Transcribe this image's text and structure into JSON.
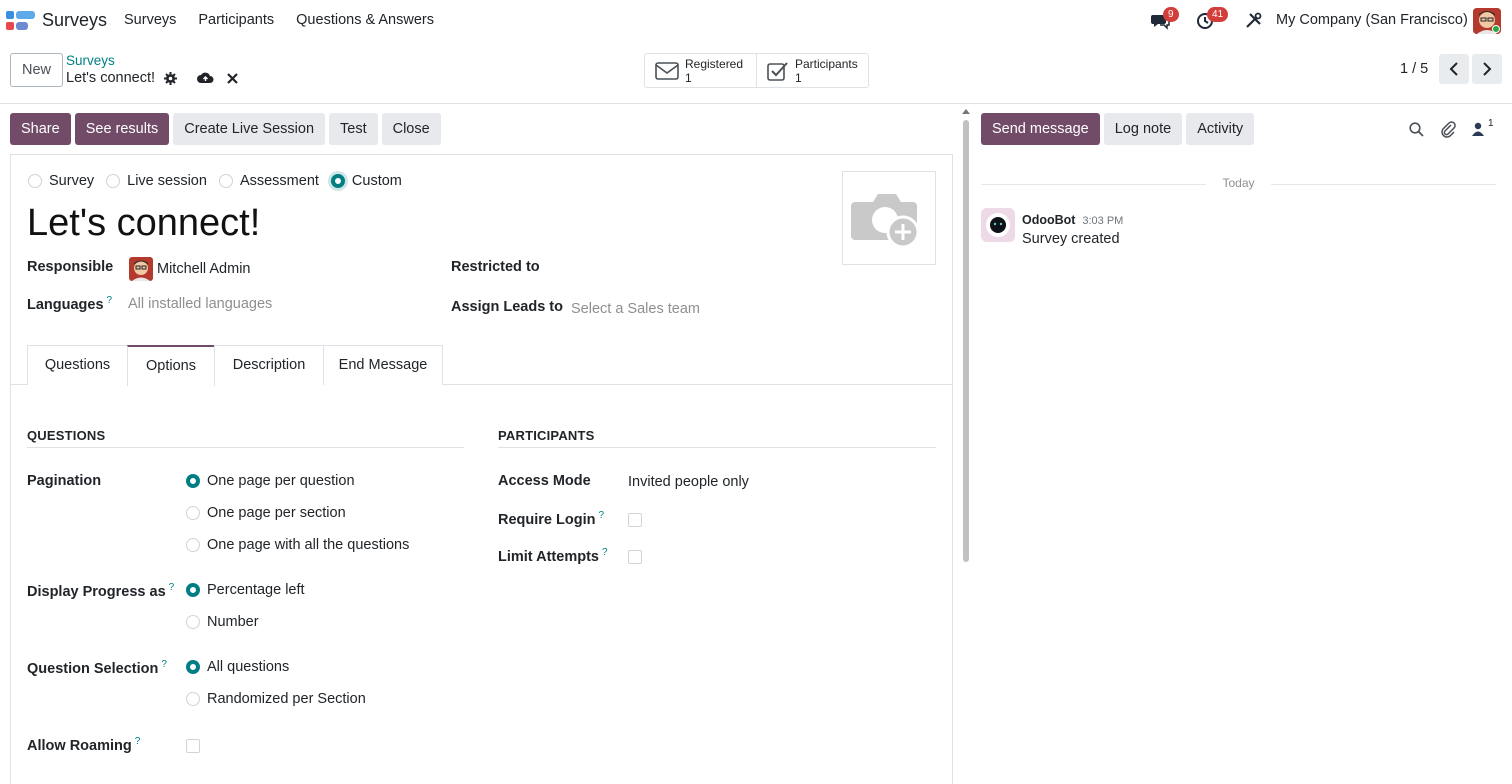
{
  "navbar": {
    "app_name": "Surveys",
    "menu": [
      "Surveys",
      "Participants",
      "Questions & Answers"
    ],
    "messages_count": "9",
    "activities_count": "41",
    "company": "My Company (San Francisco)"
  },
  "control": {
    "new_label": "New",
    "breadcrumb_parent": "Surveys",
    "breadcrumb_current": "Let's connect!",
    "smart_buttons": [
      {
        "label": "Registered",
        "count": "1",
        "icon": "envelope-icon"
      },
      {
        "label": "Participants",
        "count": "1",
        "icon": "check-square-icon"
      }
    ],
    "pager": "1 / 5"
  },
  "statusbar": {
    "buttons": [
      "Share",
      "See results",
      "Create Live Session",
      "Test",
      "Close"
    ]
  },
  "form": {
    "survey_types": [
      "Survey",
      "Live session",
      "Assessment",
      "Custom"
    ],
    "selected_type": "Custom",
    "title": "Let's connect!",
    "responsible_label": "Responsible",
    "responsible_value": "Mitchell Admin",
    "languages_label": "Languages",
    "languages_placeholder": "All installed languages",
    "restricted_label": "Restricted to",
    "assign_leads_label": "Assign Leads to",
    "assign_leads_placeholder": "Select a Sales team",
    "tabs": [
      "Questions",
      "Options",
      "Description",
      "End Message"
    ],
    "active_tab": "Options",
    "questions_section": "QUESTIONS",
    "participants_section": "PARTICIPANTS",
    "pagination_label": "Pagination",
    "pagination_options": [
      "One page per question",
      "One page per section",
      "One page with all the questions"
    ],
    "display_progress_label": "Display Progress as",
    "display_progress_options": [
      "Percentage left",
      "Number"
    ],
    "question_selection_label": "Question Selection",
    "question_selection_options": [
      "All questions",
      "Randomized per Section"
    ],
    "allow_roaming_label": "Allow Roaming",
    "access_mode_label": "Access Mode",
    "access_mode_value": "Invited people only",
    "require_login_label": "Require Login",
    "limit_attempts_label": "Limit Attempts"
  },
  "chatter": {
    "buttons": [
      "Send message",
      "Log note",
      "Activity"
    ],
    "followers_count": "1",
    "date_separator": "Today",
    "messages": [
      {
        "author": "OdooBot",
        "time": "3:03 PM",
        "body": "Survey created"
      }
    ]
  },
  "colors": {
    "primary": "#714b67",
    "accent": "#017e84",
    "badge": "#d23f3a"
  }
}
